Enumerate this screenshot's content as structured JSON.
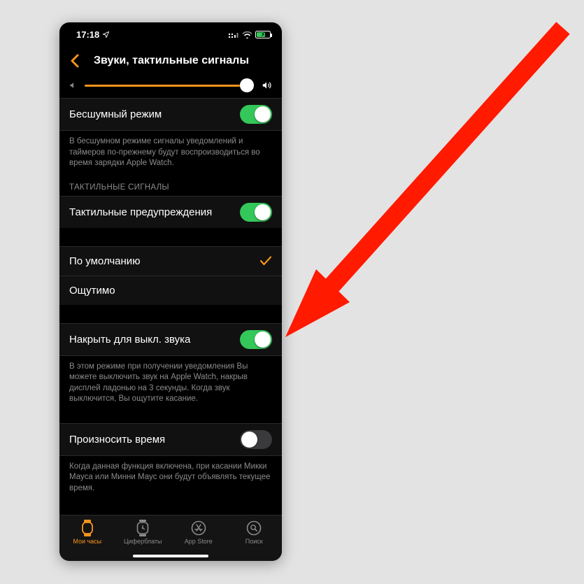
{
  "colors": {
    "accent": "#f7941d",
    "toggle_on": "#34c759",
    "bg": "#000000"
  },
  "statusbar": {
    "time": "17:18"
  },
  "header": {
    "title": "Звуки, тактильные сигналы"
  },
  "silent": {
    "label": "Бесшумный режим",
    "on": true,
    "footer": "В бесшумном режиме сигналы уведомлений и таймеров по-прежнему будут воспроизводиться во время зарядки Apple Watch."
  },
  "haptics": {
    "section_header": "ТАКТИЛЬНЫЕ СИГНАЛЫ",
    "alerts_label": "Тактильные предупреждения",
    "alerts_on": true,
    "options": [
      {
        "label": "По умолчанию",
        "selected": true
      },
      {
        "label": "Ощутимо",
        "selected": false
      }
    ]
  },
  "cover_to_mute": {
    "label": "Накрыть для выкл. звука",
    "on": true,
    "footer": "В этом режиме при получении уведомления Вы можете выключить звук на Apple Watch, накрыв дисплей ладонью на 3 секунды. Когда звук выключится, Вы ощутите касание."
  },
  "speak_time": {
    "label": "Произносить время",
    "on": false,
    "footer": "Когда данная функция включена, при касании Микки Мауса или Минни Маус они будут объявлять текущее время."
  },
  "tabbar": {
    "items": [
      {
        "label": "Мои часы",
        "active": true
      },
      {
        "label": "Циферблаты",
        "active": false
      },
      {
        "label": "App Store",
        "active": false
      },
      {
        "label": "Поиск",
        "active": false
      }
    ]
  }
}
